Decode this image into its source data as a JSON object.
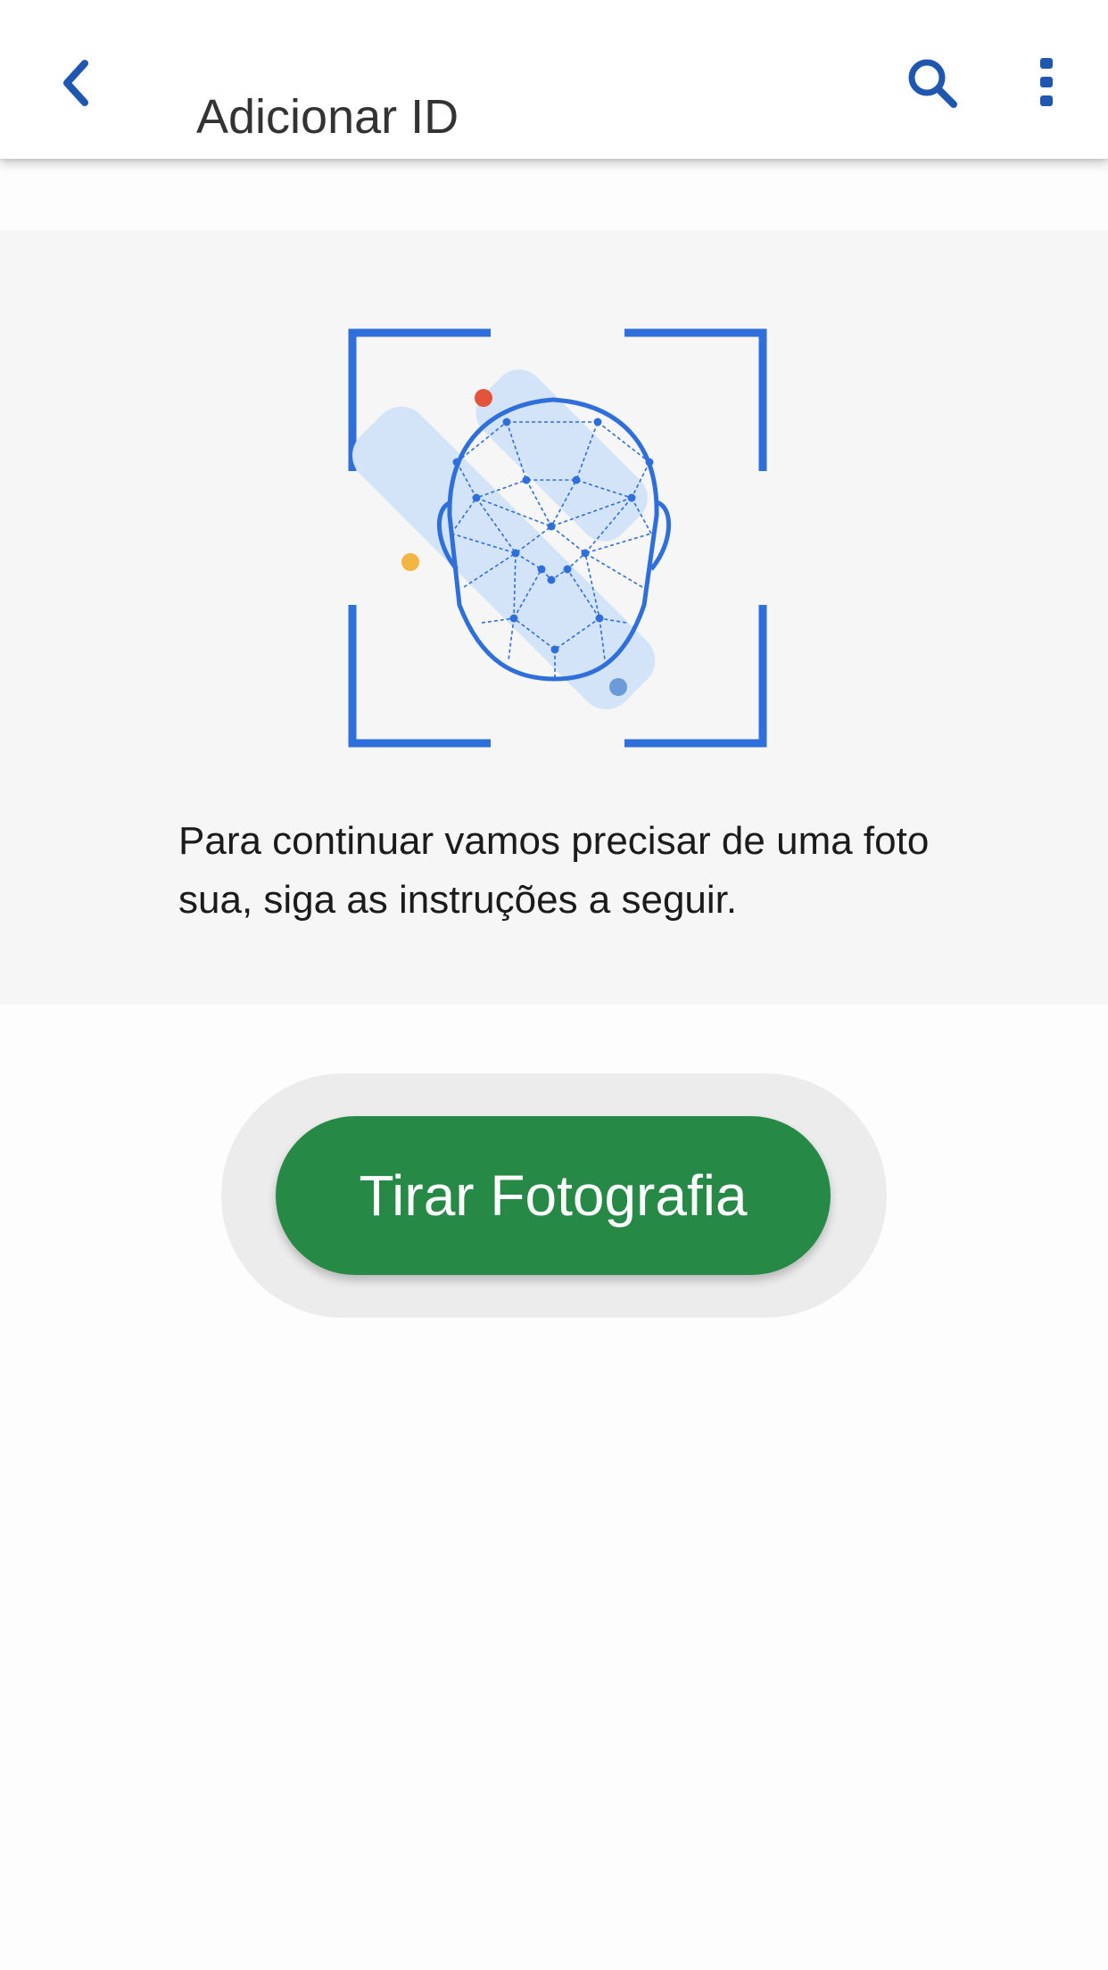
{
  "app_bar": {
    "title": "Adicionar ID",
    "back_icon": "chevron-left-icon",
    "search_icon": "search-icon",
    "menu_icon": "more-vertical-icon",
    "icon_color": "#1e56b0"
  },
  "illustration": {
    "icon": "face-recognition-icon",
    "frame_color": "#2f6fdb",
    "accent_dots": [
      "#e2543c",
      "#f4b642",
      "#6b9bd9"
    ]
  },
  "instructions": "Para continuar vamos precisar de uma foto sua, siga as instruções a seguir.",
  "primary_button": {
    "label": "Tirar Fotografia",
    "color": "#278946"
  }
}
